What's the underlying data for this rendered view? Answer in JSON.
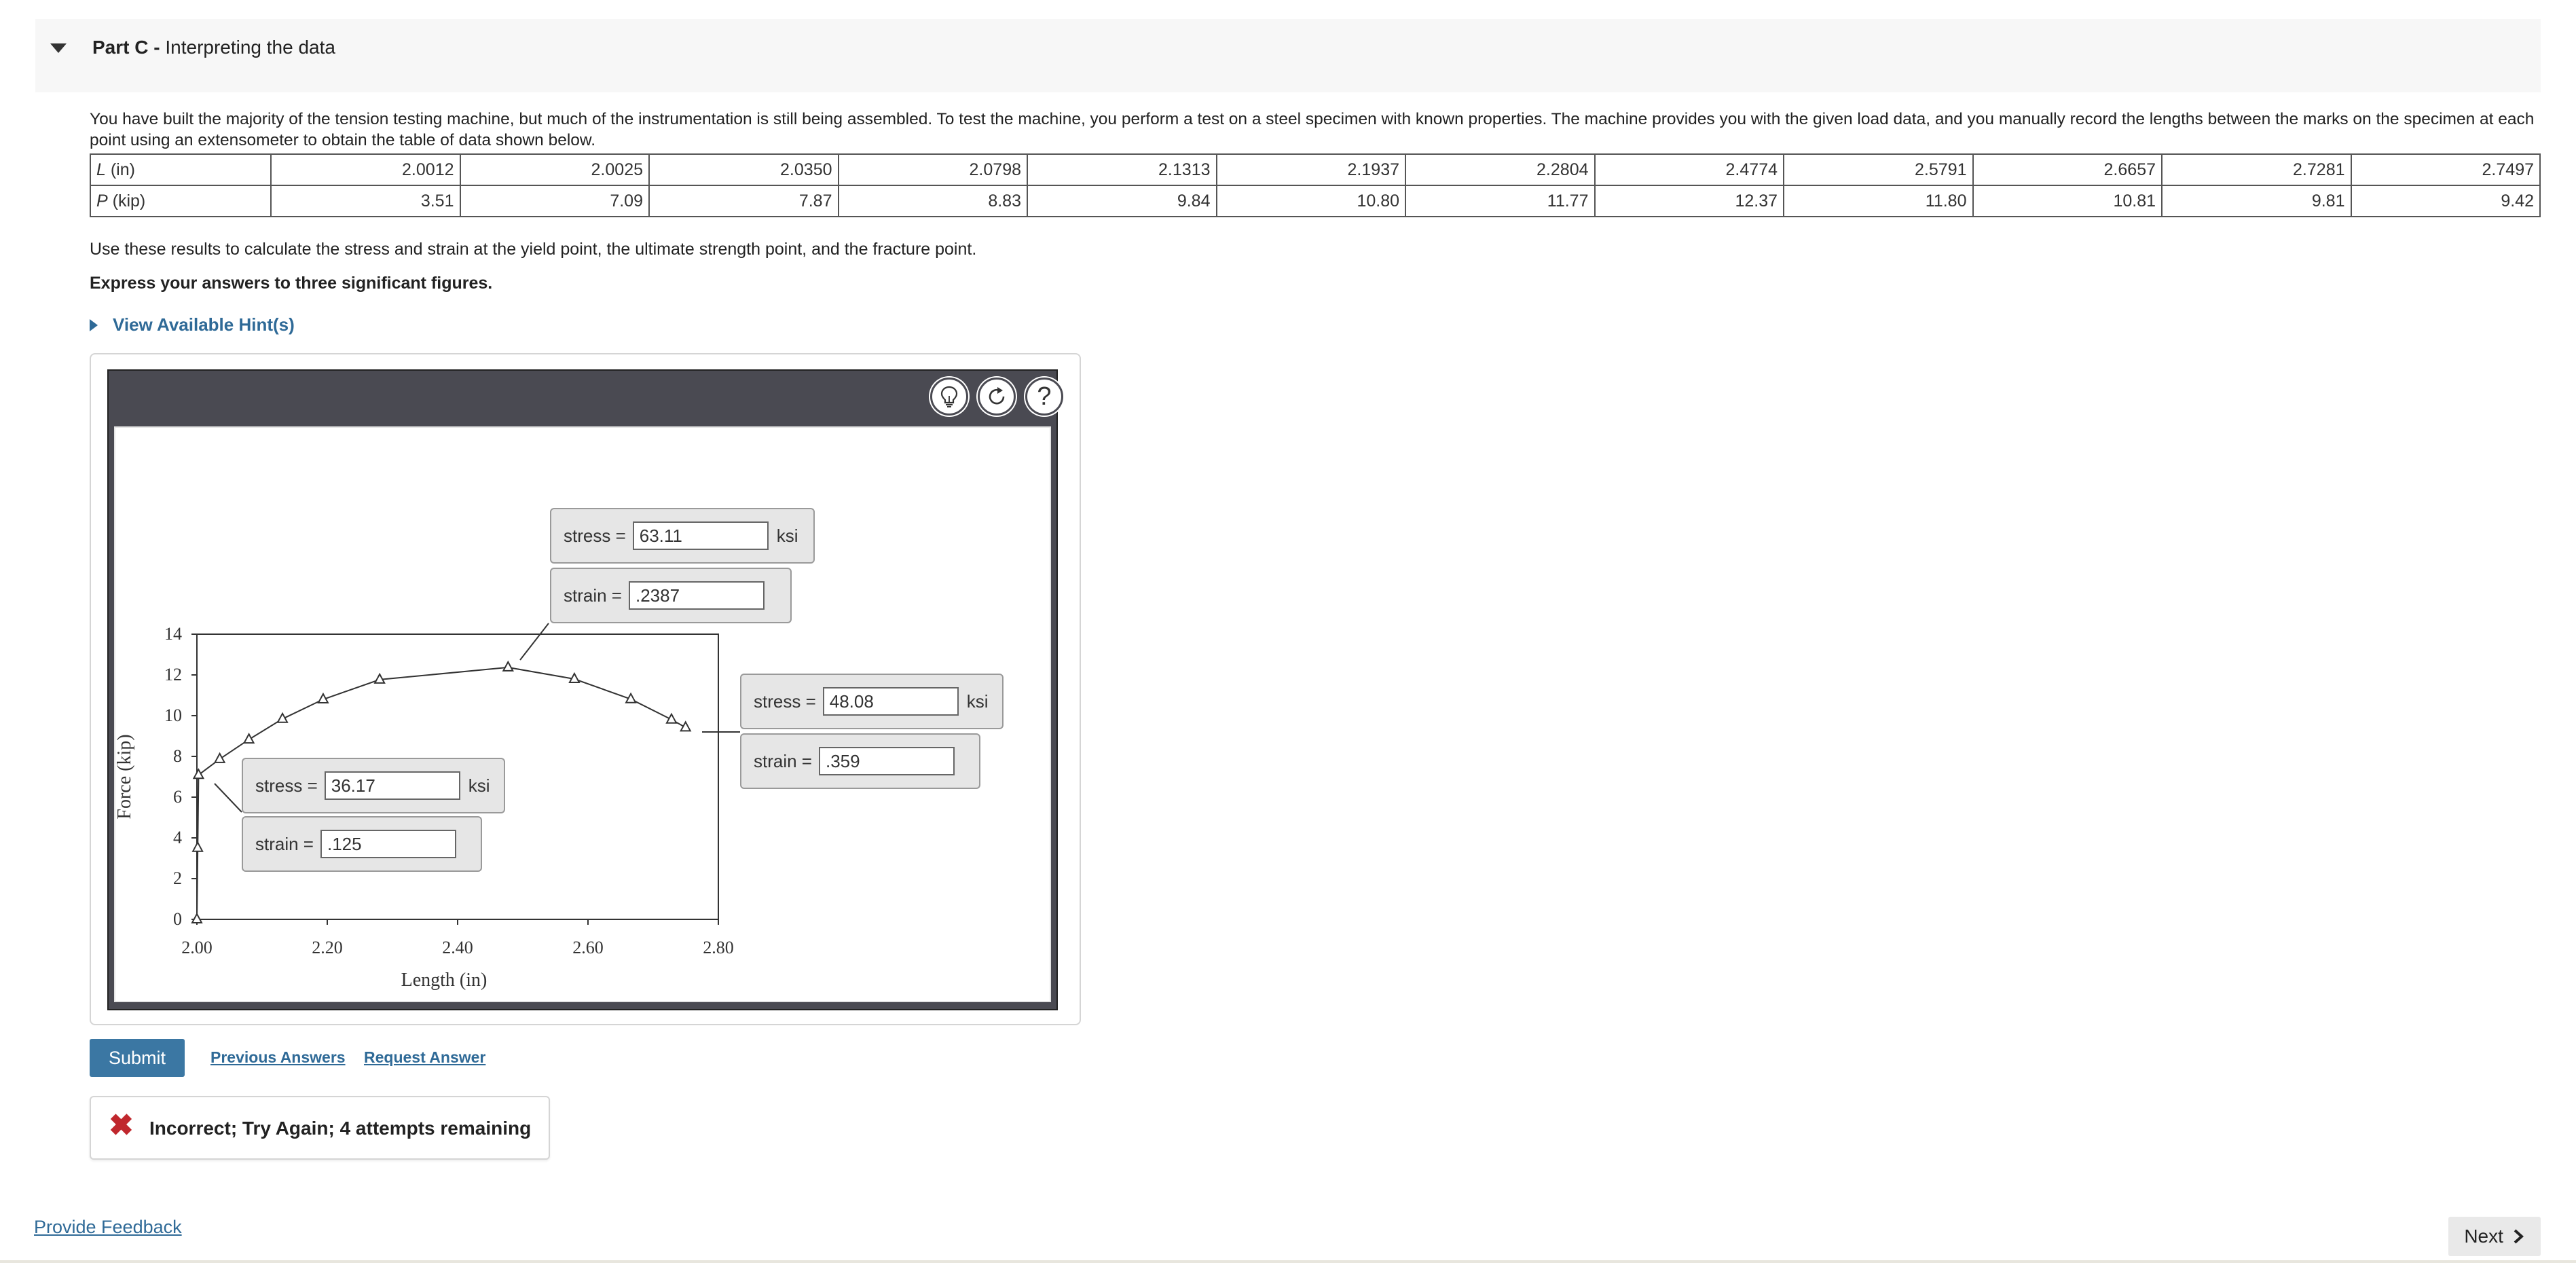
{
  "part": {
    "label": "Part C -",
    "title": "Interpreting the data"
  },
  "problem": {
    "text": "You have built the majority of the tension testing machine, but much of the instrumentation is still being assembled. To test the machine, you perform a test on a steel specimen with known properties. The machine provides you with the given load data, and you manually record the lengths between the marks on the specimen at each point using an extensometer to obtain the table of data shown below."
  },
  "table": {
    "row_labels": {
      "L_var": "L",
      "L_unit": " (in)",
      "P_var": "P",
      "P_unit": " (kip)"
    },
    "L": [
      "2.0012",
      "2.0025",
      "2.0350",
      "2.0798",
      "2.1313",
      "2.1937",
      "2.2804",
      "2.4774",
      "2.5791",
      "2.6657",
      "2.7281",
      "2.7497"
    ],
    "P": [
      "3.51",
      "7.09",
      "7.87",
      "8.83",
      "9.84",
      "10.80",
      "11.77",
      "12.37",
      "11.80",
      "10.81",
      "9.81",
      "9.42"
    ]
  },
  "instructions": {
    "calc": "Use these results to calculate the stress and strain at the yield point, the ultimate strength point, and the fracture point.",
    "express": "Express your answers to three significant figures.",
    "hint": "View Available Hint(s)"
  },
  "toolbar": {
    "hint_icon": "lightbulb-icon",
    "reset_icon": "reset-icon",
    "help_icon": "question-icon",
    "help_glyph": "?"
  },
  "answers": {
    "ultimate": {
      "stress_label": "stress =",
      "stress_value": "63.11",
      "stress_unit": "ksi",
      "strain_label": "strain =",
      "strain_value": ".2387"
    },
    "fracture": {
      "stress_label": "stress =",
      "stress_value": "48.08",
      "stress_unit": "ksi",
      "strain_label": "strain =",
      "strain_value": ".359"
    },
    "yield": {
      "stress_label": "stress =",
      "stress_value": "36.17",
      "stress_unit": "ksi",
      "strain_label": "strain =",
      "strain_value": ".125"
    }
  },
  "chart_data": {
    "type": "line",
    "xlabel": "Length (in)",
    "ylabel": "Force (kip)",
    "xlim": [
      2.0,
      2.8
    ],
    "ylim": [
      0,
      14
    ],
    "x_ticks": [
      "2.00",
      "2.20",
      "2.40",
      "2.60",
      "2.80"
    ],
    "y_ticks": [
      "0",
      "2",
      "4",
      "6",
      "8",
      "10",
      "12",
      "14"
    ],
    "grid": false,
    "series": [
      {
        "x": [
          2.0,
          2.0012,
          2.0025,
          2.035,
          2.0798,
          2.1313,
          2.1937,
          2.2804,
          2.4774,
          2.5791,
          2.6657,
          2.7281,
          2.7497
        ],
        "y": [
          0,
          3.51,
          7.09,
          7.87,
          8.83,
          9.84,
          10.8,
          11.77,
          12.37,
          11.8,
          10.81,
          9.81,
          9.42
        ]
      }
    ]
  },
  "actions": {
    "submit": "Submit",
    "previous_answers": "Previous Answers",
    "request_answer": "Request Answer"
  },
  "feedback": {
    "icon": "x-icon",
    "glyph": "✖",
    "message": "Incorrect; Try Again; 4 attempts remaining"
  },
  "footer": {
    "provide_feedback": "Provide Feedback",
    "next": "Next"
  }
}
